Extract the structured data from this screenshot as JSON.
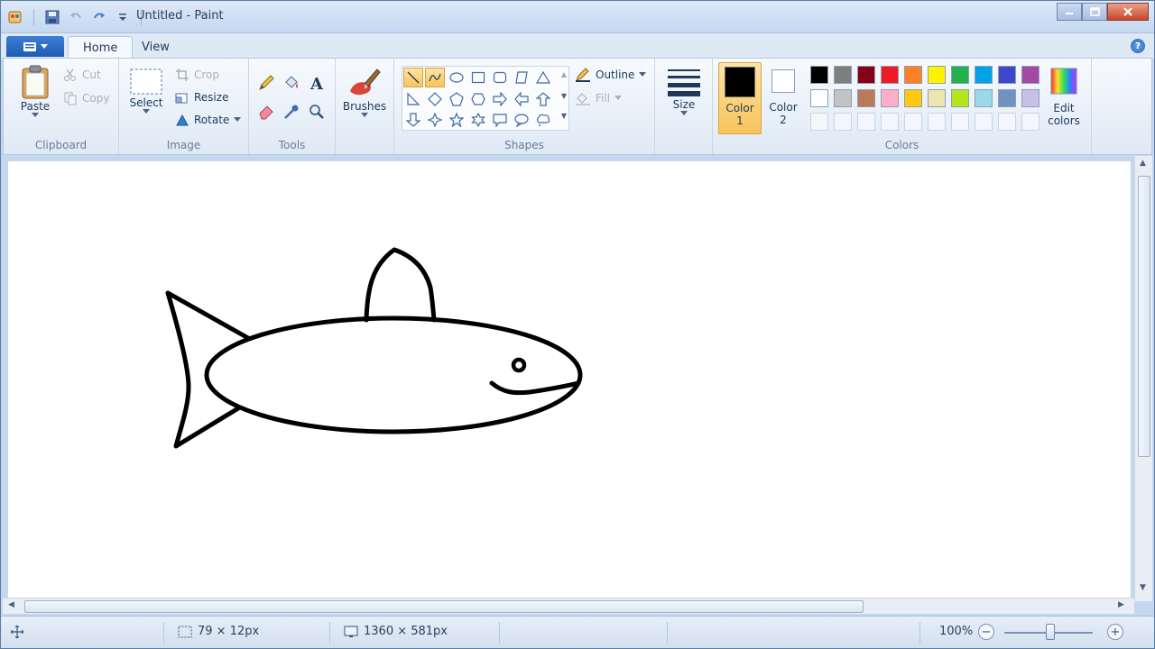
{
  "window": {
    "title": "Untitled - Paint"
  },
  "tabs": [
    {
      "label": "Home"
    },
    {
      "label": "View"
    }
  ],
  "clipboard": {
    "group_label": "Clipboard",
    "paste": "Paste",
    "cut": "Cut",
    "copy": "Copy"
  },
  "image": {
    "group_label": "Image",
    "select": "Select",
    "crop": "Crop",
    "resize": "Resize",
    "rotate": "Rotate"
  },
  "tools": {
    "group_label": "Tools"
  },
  "brushes": {
    "label": "Brushes"
  },
  "shapes": {
    "group_label": "Shapes",
    "outline": "Outline",
    "fill": "Fill"
  },
  "size": {
    "label": "Size"
  },
  "colors": {
    "group_label": "Colors",
    "color1_line1": "Color",
    "color1_line2": "1",
    "color2_line1": "Color",
    "color2_line2": "2",
    "edit_line1": "Edit",
    "edit_line2": "colors",
    "color1_value": "#000000",
    "color2_value": "#ffffff",
    "palette_row1": [
      "#000000",
      "#7f7f7f",
      "#880015",
      "#ed1c24",
      "#ff7f27",
      "#fff200",
      "#22b14c",
      "#00a2e8",
      "#3f48cc",
      "#a349a4"
    ],
    "palette_row2": [
      "#ffffff",
      "#c3c3c3",
      "#b97a57",
      "#ffaec9",
      "#ffc90e",
      "#efe4b0",
      "#b5e61d",
      "#99d9ea",
      "#7092be",
      "#c8bfe7"
    ]
  },
  "status": {
    "selection_size": "79 × 12px",
    "image_size": "1360 × 581px",
    "zoom": "100%"
  }
}
